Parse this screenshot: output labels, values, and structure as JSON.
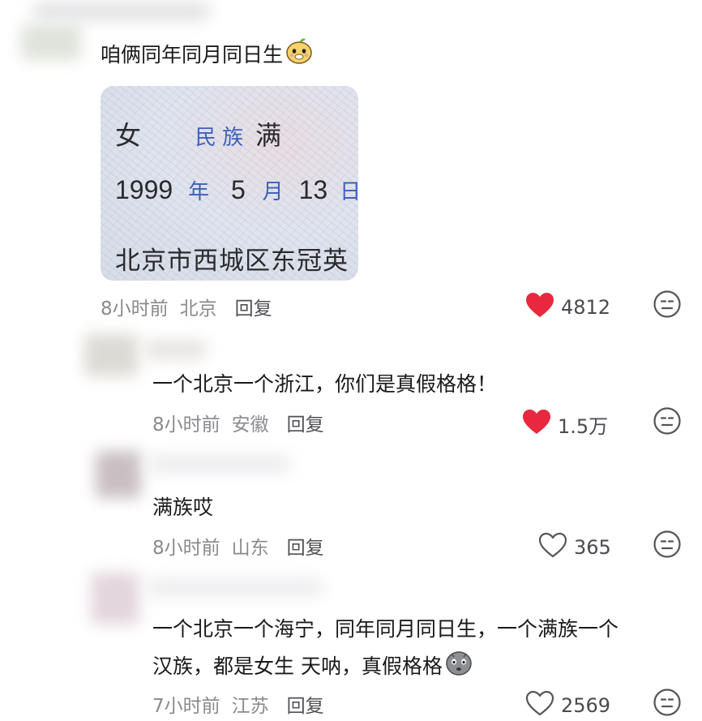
{
  "comment1": {
    "text": "咱俩同年同月同日生",
    "photo": {
      "sex": "女",
      "ethnic_label": "民 族",
      "ethnic": "满",
      "year": "1999",
      "year_unit": "年",
      "month": "5",
      "month_unit": "月",
      "day": "13",
      "day_unit": "日",
      "address": "北京市西城区东冠英"
    },
    "time": "8小时前",
    "location": "北京",
    "reply": "回复",
    "likes": "4812"
  },
  "reply1": {
    "text": "一个北京一个浙江，你们是真假格格！",
    "time": "8小时前",
    "location": "安徽",
    "reply": "回复",
    "likes": "1.5万"
  },
  "reply2": {
    "text": "满族哎",
    "time": "8小时前",
    "location": "山东",
    "reply": "回复",
    "likes": "365"
  },
  "reply3": {
    "text_line1": "一个北京一个海宁，同年同月同日生，一个满族一个",
    "text_line2": "汉族，都是女生 天呐，真假格格",
    "time": "7小时前",
    "location": "江苏",
    "reply": "回复",
    "likes": "2569"
  },
  "colors": {
    "liked_heart": "#e8283f",
    "meta_gray": "#8a8a8f"
  },
  "icons": [
    "heart-filled-icon",
    "heart-outline-icon",
    "sticker-emoji-icon"
  ]
}
